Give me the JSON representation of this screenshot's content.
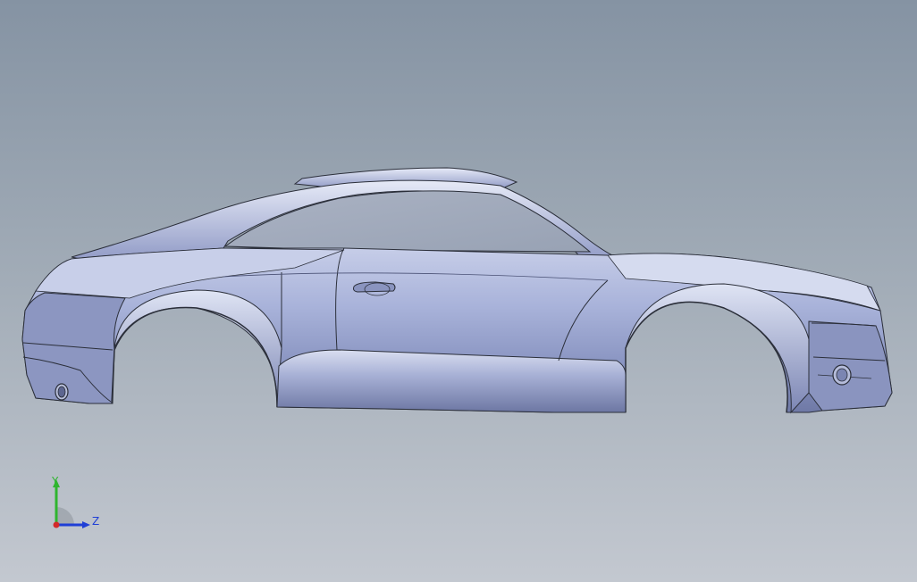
{
  "viewport": {
    "background_top": "#8593a3",
    "background_bottom": "#c3c8d0",
    "model": {
      "body_color": "#9ea9cf",
      "body_highlight": "#e3e8f6",
      "body_shadow": "#5d6690",
      "edge_color": "#2b2f3a"
    },
    "triad": {
      "y_label": "Y",
      "z_label": "Z",
      "y_color": "#2fb52f",
      "z_color": "#1f3fd6",
      "origin_color": "#d32a2a"
    }
  }
}
